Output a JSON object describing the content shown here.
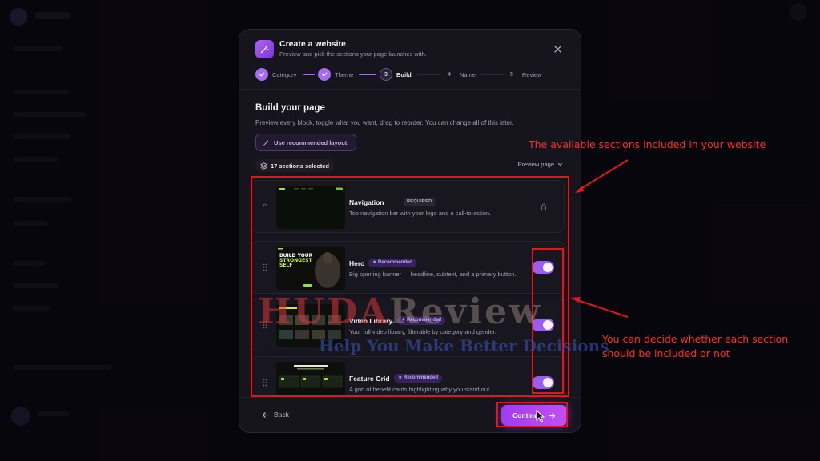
{
  "modal": {
    "title": "Create a website",
    "subtitle": "Preview and pick the sections your page launches with.",
    "steps": [
      {
        "number": "1",
        "label": "Category",
        "state": "done"
      },
      {
        "number": "2",
        "label": "Theme",
        "state": "done"
      },
      {
        "number": "3",
        "label": "Build",
        "state": "active"
      },
      {
        "number": "4",
        "label": "Name",
        "state": "todo"
      },
      {
        "number": "5",
        "label": "Review",
        "state": "todo"
      }
    ],
    "heading": "Build your page",
    "description": "Preview every block, toggle what you want, drag to reorder. You can change all of this later.",
    "recommended_button": "Use recommended layout",
    "selected_count": "17 sections selected",
    "preview_dropdown": "Preview page",
    "sections": [
      {
        "name": "Navigation",
        "badge": "REQUIRED",
        "description": "Top navigation bar with your logo and a call-to-action.",
        "locked": true,
        "enabled": true
      },
      {
        "name": "Hero",
        "badge": "Recommended",
        "description": "Big opening banner — headline, subtext, and a primary button.",
        "locked": false,
        "enabled": true,
        "thumb_text": [
          "BUILD YOUR",
          "STRONGEST",
          "SELF"
        ]
      },
      {
        "name": "Video Library",
        "badge": "Recommended",
        "description": "Your full video library, filterable by category and gender.",
        "locked": false,
        "enabled": true
      },
      {
        "name": "Feature Grid",
        "badge": "Recommended",
        "description": "A grid of benefit cards highlighting why you stand out.",
        "locked": false,
        "enabled": true
      }
    ],
    "back_label": "Back",
    "continue_label": "Continue"
  },
  "annotations": {
    "sections_note": "The available sections included in your website",
    "toggle_note_line1": "You can decide whether each section",
    "toggle_note_line2": "should be included or not"
  },
  "watermark": {
    "brand_part1": "HUDA",
    "brand_part2": "Review",
    "tagline": "Help You Make Better Decisions"
  },
  "colors": {
    "accent": "#a66bf0",
    "toggle_on": "#9b5df0",
    "annotation": "#e8141c"
  }
}
